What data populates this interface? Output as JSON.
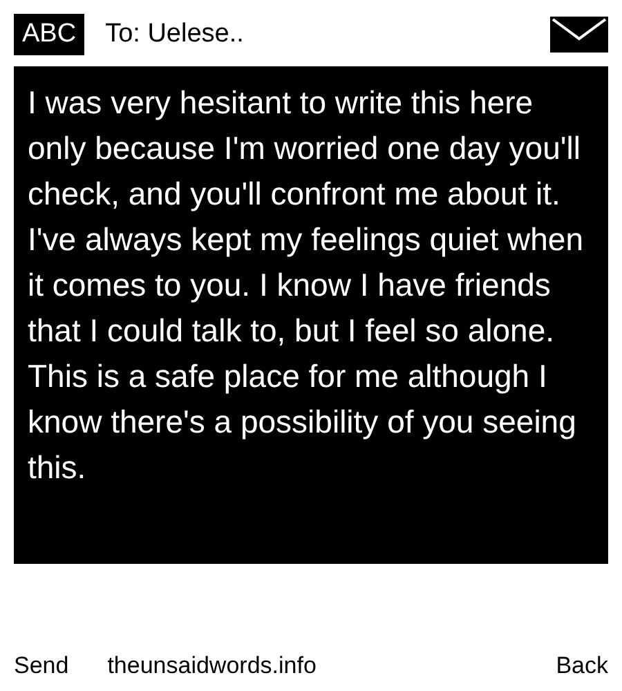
{
  "header": {
    "badge": "ABC",
    "recipient": "To: Uelese.."
  },
  "message": "I was very hesitant to write this here only because I'm worried one day you'll check, and you'll confront me about it. I've always kept my feelings quiet when it comes to you. I know I have friends that I could talk to, but I feel so alone. This is a safe place for me although I know there's a possibility of you seeing this.",
  "footer": {
    "left": "Send",
    "center": "theunsaidwords.info",
    "right": "Back"
  }
}
